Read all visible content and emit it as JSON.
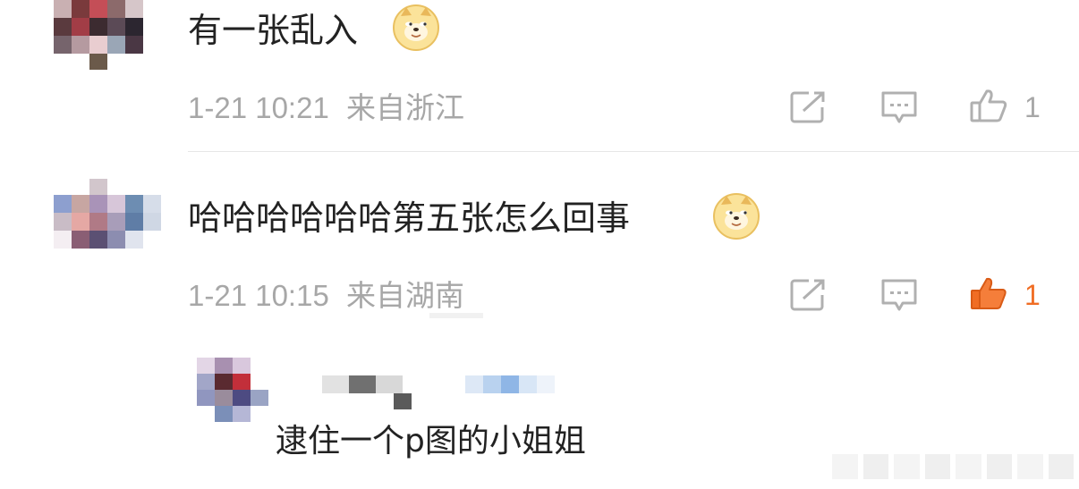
{
  "colors": {
    "text": "#222222",
    "meta": "#a7a7a7",
    "icon": "#b0b0b0",
    "liked": "#f06d24"
  },
  "comments": [
    {
      "text": "有一张乱入",
      "emoji": "doge-emoji",
      "time": "1-21 10:21",
      "location": "来自浙江",
      "likes": "1",
      "liked": false
    },
    {
      "text": "哈哈哈哈哈哈第五张怎么回事",
      "emoji": "doge-emoji",
      "time": "1-21 10:15",
      "location": "来自湖南",
      "likes": "1",
      "liked": true
    }
  ],
  "reply": {
    "text": "逮住一个p图的小姐姐"
  },
  "icons": {
    "share": "share-icon",
    "comment": "comment-icon",
    "like": "thumbs-up-icon"
  }
}
